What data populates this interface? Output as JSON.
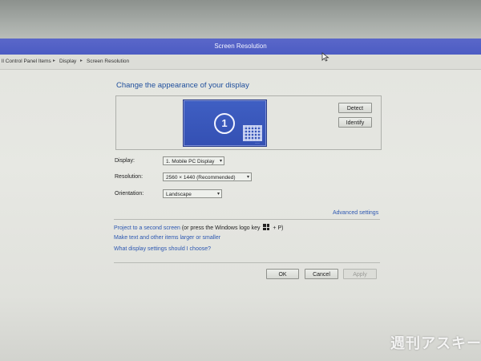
{
  "window": {
    "title": "Screen Resolution"
  },
  "breadcrumb": [
    "ll Control Panel Items",
    "Display",
    "Screen Resolution"
  ],
  "main": {
    "heading": "Change the appearance of your display",
    "monitor_number": "1",
    "detect_label": "Detect",
    "identify_label": "Identify"
  },
  "settings": {
    "display_label": "Display:",
    "display_value": "1. Mobile PC Display",
    "resolution_label": "Resolution:",
    "resolution_value": "2560 × 1440 (Recommended)",
    "orientation_label": "Orientation:",
    "orientation_value": "Landscape",
    "advanced_label": "Advanced settings"
  },
  "links": {
    "project": "Project to a second screen",
    "project_suffix_pre": "(or press the Windows logo key",
    "project_suffix_post": "+ P)",
    "text_size": "Make text and other items larger or smaller",
    "help": "What display settings should I choose?"
  },
  "footer": {
    "ok_label": "OK",
    "cancel_label": "Cancel",
    "apply_label": "Apply"
  },
  "watermark": "週刊アスキー",
  "colors": {
    "titlebar": "#4c5cc3",
    "link": "#2c57b1",
    "heading": "#1f4f9c",
    "monitor": "#3450b3"
  },
  "icons": [
    "chevron-right-icon",
    "windows-logo-icon",
    "chevron-down-icon",
    "mouse-cursor-icon",
    "grid-icon"
  ]
}
